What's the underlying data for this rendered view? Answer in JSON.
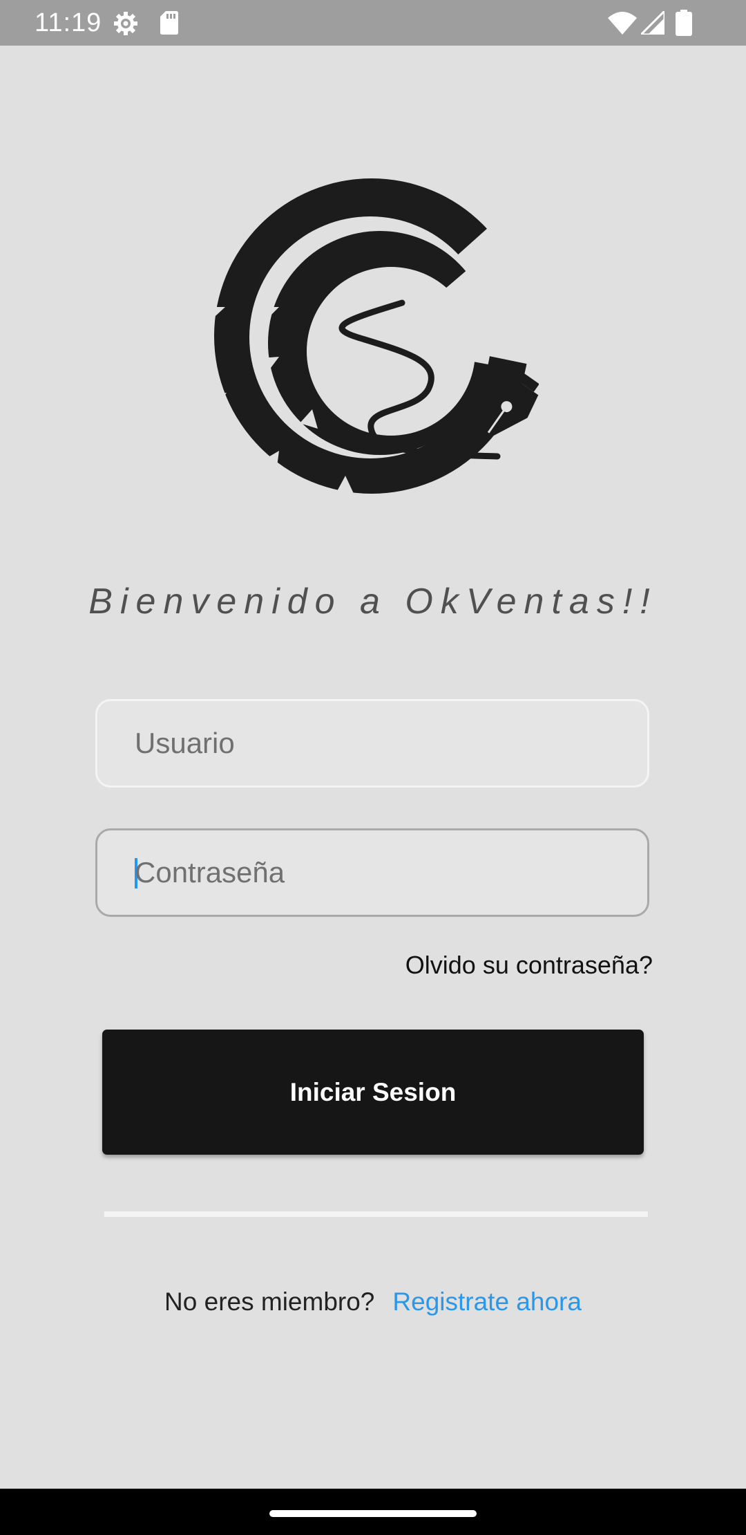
{
  "status_bar": {
    "time": "11:19",
    "left_icons": [
      "settings-gear-icon",
      "sd-card-icon"
    ],
    "right_icons": [
      "wifi-icon",
      "signal-icon",
      "battery-icon"
    ]
  },
  "logo": {
    "icon": "okventas-pen-swirl-logo"
  },
  "welcome_text": "Bienvenido a OkVentas!!",
  "form": {
    "username_placeholder": "Usuario",
    "password_placeholder": "Contraseña",
    "forgot_password_label": "Olvido su contraseña?",
    "login_button_label": "Iniciar Sesion"
  },
  "signup": {
    "question": "No eres miembro?",
    "link_label": "Registrate ahora"
  },
  "colors": {
    "background": "#e0e0e0",
    "status_bar": "#9e9e9e",
    "button": "#161616",
    "link": "#2b97e8",
    "caret": "#2196f3"
  }
}
